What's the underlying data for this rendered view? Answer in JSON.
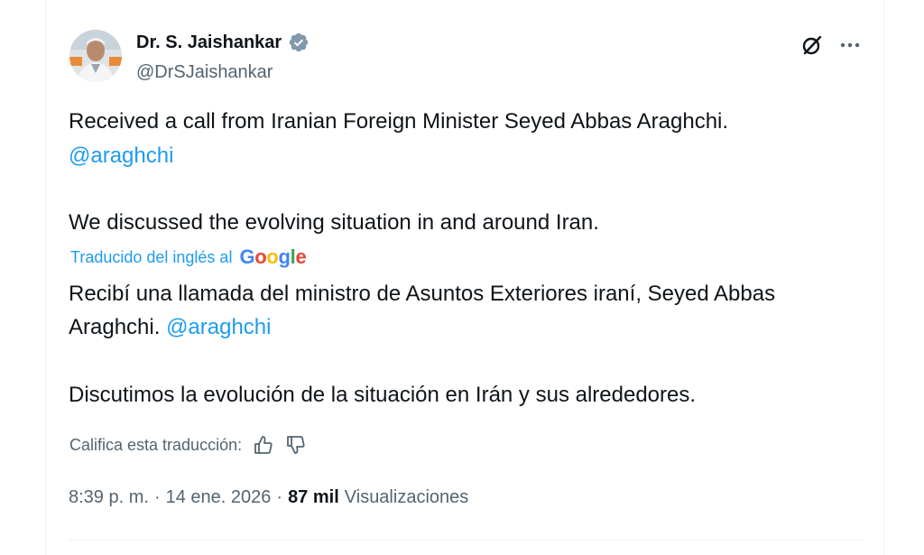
{
  "author": {
    "name": "Dr. S. Jaishankar",
    "handle": "@DrSJaishankar"
  },
  "icons": {
    "verified": "verified-badge-icon",
    "grok": "grok-icon",
    "more": "more-options-icon",
    "thumbs_up": "thumbs-up-icon",
    "thumbs_down": "thumbs-down-icon"
  },
  "original": {
    "line1": "Received a call from Iranian Foreign Minister Seyed Abbas Araghchi.",
    "mention": "@araghchi",
    "line3": "We discussed the evolving situation in and around Iran."
  },
  "translation": {
    "label": "Traducido del inglés al",
    "provider": {
      "g1": "G",
      "o1": "o",
      "o2": "o",
      "g2": "g",
      "l": "l",
      "e": "e"
    },
    "line1": "Recibí una llamada del ministro de Asuntos Exteriores iraní, Seyed Abbas",
    "line2_prefix": "Araghchi.",
    "mention": "@araghchi",
    "line3": "Discutimos la evolución de la situación en Irán y sus alrededores."
  },
  "rating": {
    "label": "Califica esta traducción:"
  },
  "meta": {
    "time": "8:39 p. m.",
    "date": "14 ene. 2026",
    "views_count": "87 mil",
    "views_label": "Visualizaciones"
  },
  "colors": {
    "accent": "#1d9bf0",
    "text": "#0f1419",
    "secondary": "#536471"
  }
}
